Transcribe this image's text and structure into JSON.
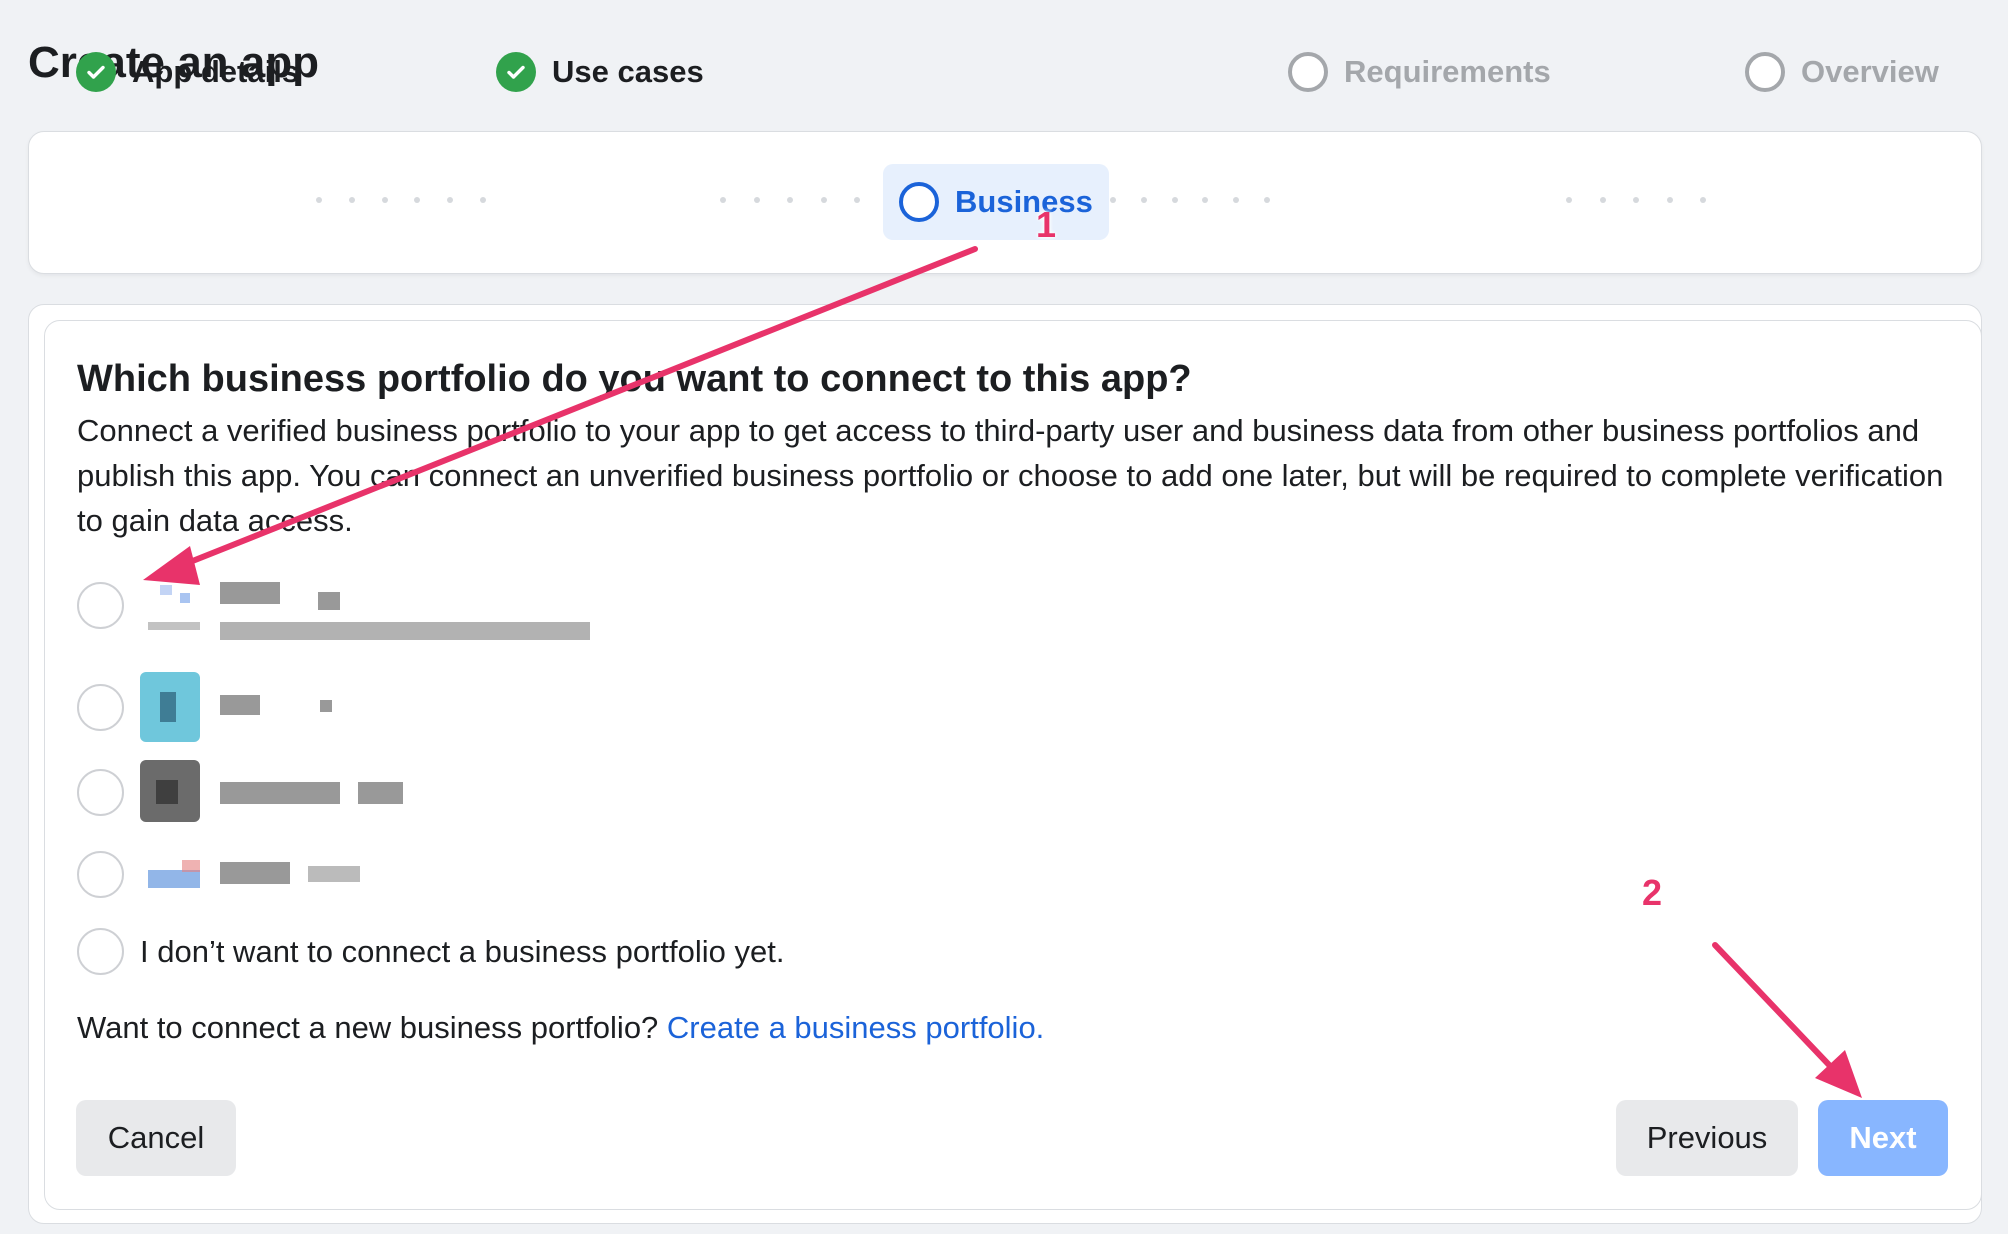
{
  "page": {
    "title": "Create an app"
  },
  "stepper": {
    "steps": [
      {
        "label": "App details",
        "status": "done"
      },
      {
        "label": "Use cases",
        "status": "done"
      },
      {
        "label": "Business",
        "status": "active"
      },
      {
        "label": "Requirements",
        "status": "todo"
      },
      {
        "label": "Overview",
        "status": "todo"
      }
    ]
  },
  "business": {
    "question": "Which business portfolio do you want to connect to this app?",
    "description": "Connect a verified business portfolio to your app to get access to third-party user and business data from other business portfolios and publish this app. You can connect an unverified business portfolio or choose to add one later, but will be required to complete verification to gain data access.",
    "none_option": "I don’t want to connect a business portfolio yet.",
    "footer_prompt": "Want to connect a new business portfolio?",
    "footer_link": "Create a business portfolio."
  },
  "buttons": {
    "cancel": "Cancel",
    "previous": "Previous",
    "next": "Next"
  },
  "annotations": {
    "one": "1",
    "two": "2"
  },
  "colors": {
    "accent": "#1b63d9",
    "success": "#31a24c",
    "annotation": "#e8336a",
    "next_disabled": "#88b6ff"
  }
}
